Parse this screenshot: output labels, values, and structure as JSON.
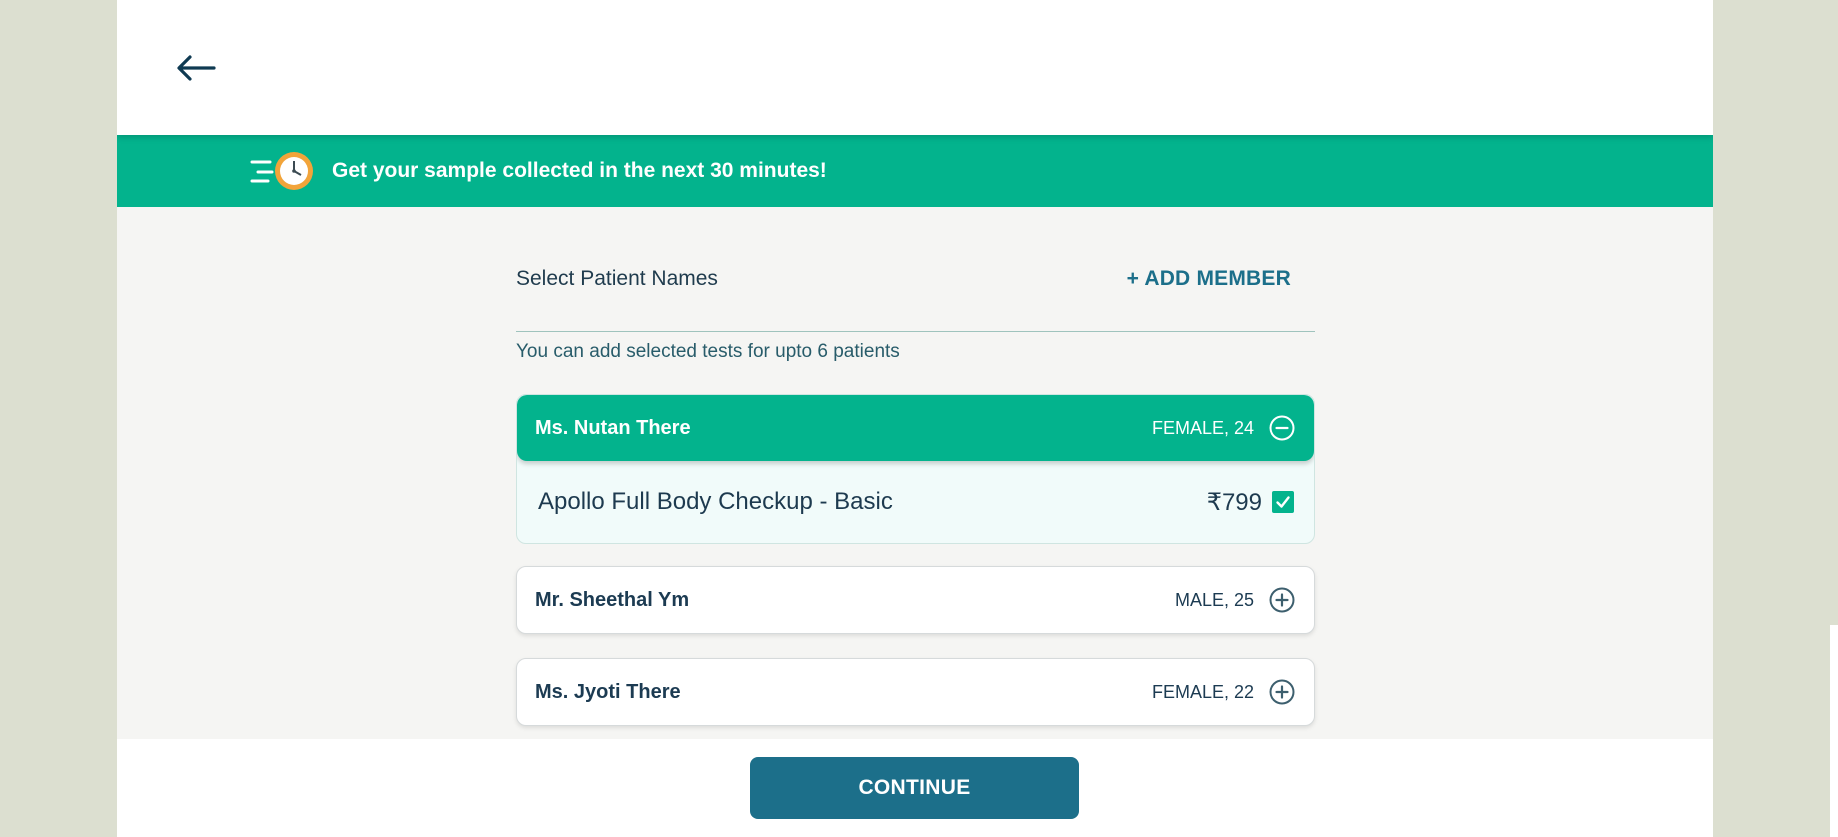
{
  "header": {
    "back_icon": "arrow-left-icon"
  },
  "banner": {
    "icon": "fast-clock-icon",
    "text": "Get your sample collected in the next 30 minutes!"
  },
  "patients_section": {
    "title": "Select Patient Names",
    "add_member_label": "+ ADD MEMBER",
    "hint": "You can add selected tests for upto 6 patients"
  },
  "patients": [
    {
      "name": "Ms. Nutan There",
      "meta": "FEMALE, 24",
      "selected": true,
      "toggle_icon": "minus-circle-icon",
      "tests": [
        {
          "name": "Apollo Full Body Checkup - Basic",
          "price": "₹799",
          "checked": true
        }
      ]
    },
    {
      "name": "Mr. Sheethal Ym",
      "meta": "MALE, 25",
      "selected": false,
      "toggle_icon": "plus-circle-icon"
    },
    {
      "name": "Ms. Jyoti There",
      "meta": "FEMALE, 22",
      "selected": false,
      "toggle_icon": "plus-circle-icon"
    }
  ],
  "footer": {
    "continue_label": "CONTINUE"
  },
  "colors": {
    "accent_green": "#03b38d",
    "primary_blue": "#1c6f8a",
    "text_dark": "#1c3b52",
    "outer_background": "#dcdfd0"
  }
}
